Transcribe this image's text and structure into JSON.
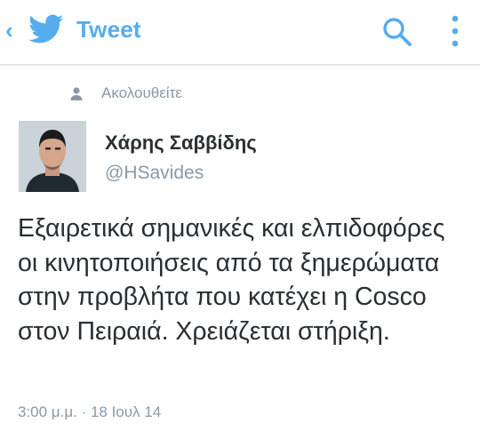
{
  "header": {
    "back_glyph": "‹",
    "title": "Tweet",
    "icons": {
      "back": "chevron-left-icon",
      "logo": "twitter-bird-icon",
      "search": "search-icon",
      "menu": "more-vertical-icon"
    }
  },
  "tweet": {
    "social_context": "Ακολουθείτε",
    "author": {
      "display_name": "Χάρης Σαββίδης",
      "screen_name": "@HSavides"
    },
    "text": "Εξαιρετικά σημανικές και ελπιδοφόρες οι κινητοποιήσεις από τα ξημερώματα στην προβλήτα που κατέχει η Cosco στον Πειραιά. Χρειάζεται στήριξη.",
    "timestamp": "3:00 μ.μ. · 18 Ιουλ 14"
  },
  "colors": {
    "accent": "#55acee",
    "text": "#292f33",
    "muted": "#8899a6",
    "divider": "#e3e7ea"
  }
}
